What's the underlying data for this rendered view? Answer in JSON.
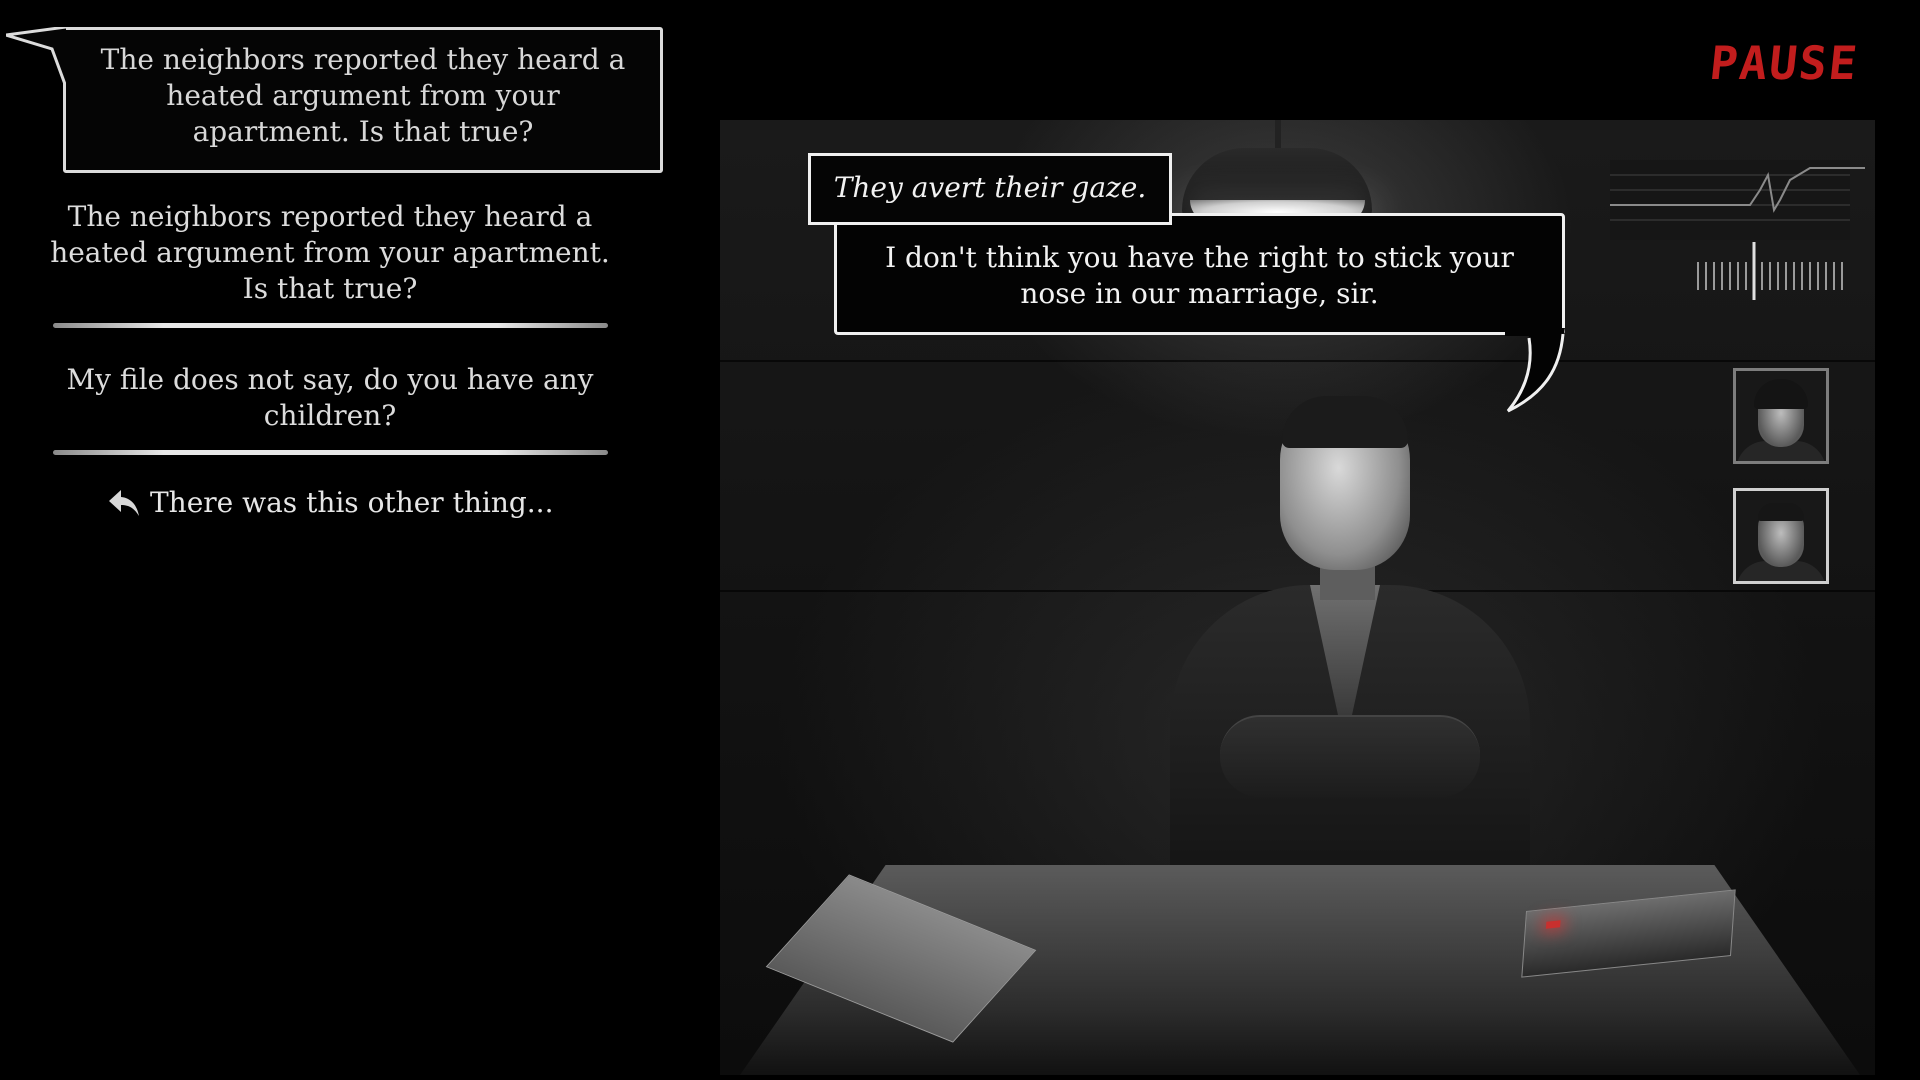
{
  "hud": {
    "pause_label": "PAUSE"
  },
  "question": {
    "text": "The neighbors reported they heard a heated argument from your apartment. Is that true?"
  },
  "options": [
    {
      "text": "The neighbors reported they heard a heated argument from your apartment. Is that true?"
    },
    {
      "text": "My file does not say, do you have any children?"
    }
  ],
  "back_option": {
    "label": "There was this other thing...",
    "icon": "reply-arrow-icon"
  },
  "narration": {
    "text": "They avert their gaze."
  },
  "response": {
    "text": "I don't think you have the right to stick your nose in our marriage, sir."
  },
  "portraits": [
    {
      "name": "portrait-beanie-suspect",
      "selected": false
    },
    {
      "name": "portrait-suit-suspect",
      "selected": true
    }
  ],
  "colors": {
    "pause": "#c21d1d",
    "text": "#e4e4e4",
    "background": "#000000"
  }
}
